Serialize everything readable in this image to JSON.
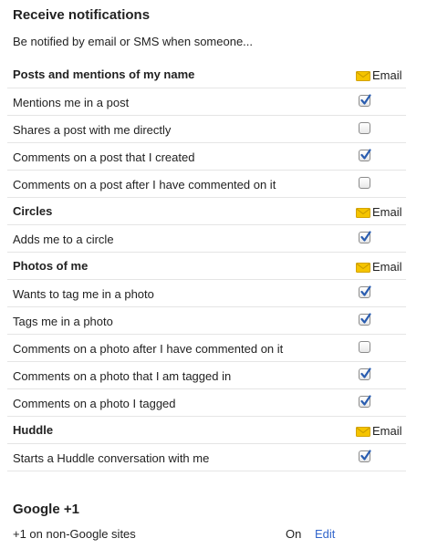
{
  "header": {
    "title": "Receive notifications",
    "subtitle": "Be notified by email or SMS when someone..."
  },
  "email_label": "Email",
  "icons": {
    "email": "envelope-icon",
    "checked": "checkbox-checked",
    "unchecked": "checkbox-unchecked"
  },
  "colors": {
    "envelope": "#f5c400",
    "check": "#2a5db0",
    "link": "#3366cc"
  },
  "sections": [
    {
      "title": "Posts and mentions of my name",
      "items": [
        {
          "label": "Mentions me in a post",
          "email": true
        },
        {
          "label": "Shares a post with me directly",
          "email": false
        },
        {
          "label": "Comments on a post that I created",
          "email": true
        },
        {
          "label": "Comments on a post after I have commented on it",
          "email": false
        }
      ]
    },
    {
      "title": "Circles",
      "items": [
        {
          "label": "Adds me to a circle",
          "email": true
        }
      ]
    },
    {
      "title": "Photos of me",
      "items": [
        {
          "label": "Wants to tag me in a photo",
          "email": true
        },
        {
          "label": "Tags me in a photo",
          "email": true
        },
        {
          "label": "Comments on a photo after I have commented on it",
          "email": false
        },
        {
          "label": "Comments on a photo that I am tagged in",
          "email": true
        },
        {
          "label": "Comments on a photo I tagged",
          "email": true
        }
      ]
    },
    {
      "title": "Huddle",
      "items": [
        {
          "label": "Starts a Huddle conversation with me",
          "email": true
        }
      ]
    }
  ],
  "google_plus_one": {
    "title": "Google +1",
    "setting_label": "+1 on non-Google sites",
    "status": "On",
    "edit_label": "Edit"
  }
}
